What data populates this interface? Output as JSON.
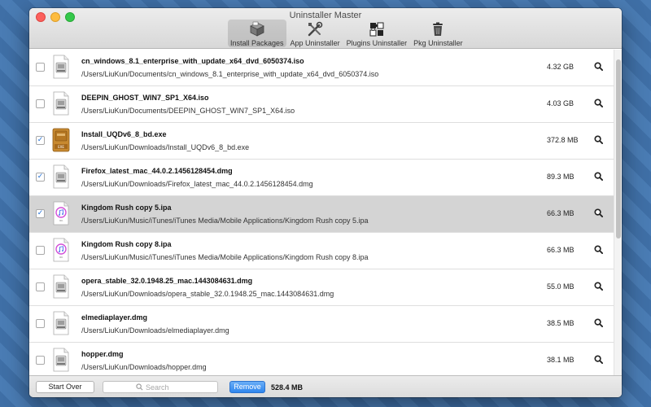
{
  "window": {
    "title": "Uninstaller Master"
  },
  "toolbar": {
    "items": [
      {
        "label": "Install Packages",
        "icon": "box-icon",
        "active": true
      },
      {
        "label": "App Uninstaller",
        "icon": "tools-icon",
        "active": false
      },
      {
        "label": "Plugins Uninstaller",
        "icon": "puzzle-icon",
        "active": false
      },
      {
        "label": "Pkg Uninstaller",
        "icon": "trash-icon",
        "active": false
      }
    ]
  },
  "files": [
    {
      "name": "cn_windows_8.1_enterprise_with_update_x64_dvd_6050374.iso",
      "path": "/Users/LiuKun/Documents/cn_windows_8.1_enterprise_with_update_x64_dvd_6050374.iso",
      "size": "4.32 GB",
      "checked": false,
      "selected": false,
      "icon": "disk-image-icon"
    },
    {
      "name": "DEEPIN_GHOST_WIN7_SP1_X64.iso",
      "path": "/Users/LiuKun/Documents/DEEPIN_GHOST_WIN7_SP1_X64.iso",
      "size": "4.03 GB",
      "checked": false,
      "selected": false,
      "icon": "disk-image-icon"
    },
    {
      "name": "Install_UQDv6_8_bd.exe",
      "path": "/Users/LiuKun/Downloads/Install_UQDv6_8_bd.exe",
      "size": "372.8 MB",
      "checked": true,
      "selected": false,
      "icon": "exe-icon"
    },
    {
      "name": "Firefox_latest_mac_44.0.2.1456128454.dmg",
      "path": "/Users/LiuKun/Downloads/Firefox_latest_mac_44.0.2.1456128454.dmg",
      "size": "89.3 MB",
      "checked": true,
      "selected": false,
      "icon": "disk-image-icon"
    },
    {
      "name": "Kingdom Rush copy 5.ipa",
      "path": "/Users/LiuKun/Music/iTunes/iTunes Media/Mobile Applications/Kingdom Rush copy 5.ipa",
      "size": "66.3 MB",
      "checked": true,
      "selected": true,
      "icon": "ipa-icon"
    },
    {
      "name": "Kingdom Rush copy 8.ipa",
      "path": "/Users/LiuKun/Music/iTunes/iTunes Media/Mobile Applications/Kingdom Rush copy 8.ipa",
      "size": "66.3 MB",
      "checked": false,
      "selected": false,
      "icon": "ipa-icon"
    },
    {
      "name": "opera_stable_32.0.1948.25_mac.1443084631.dmg",
      "path": "/Users/LiuKun/Downloads/opera_stable_32.0.1948.25_mac.1443084631.dmg",
      "size": "55.0 MB",
      "checked": false,
      "selected": false,
      "icon": "disk-image-icon"
    },
    {
      "name": "elmediaplayer.dmg",
      "path": "/Users/LiuKun/Downloads/elmediaplayer.dmg",
      "size": "38.5 MB",
      "checked": false,
      "selected": false,
      "icon": "disk-image-icon"
    },
    {
      "name": "hopper.dmg",
      "path": "/Users/LiuKun/Downloads/hopper.dmg",
      "size": "38.1 MB",
      "checked": false,
      "selected": false,
      "icon": "disk-image-icon"
    }
  ],
  "footer": {
    "start_over_label": "Start Over",
    "search_placeholder": "Search",
    "remove_label": "Remove",
    "total_size": "528.4 MB"
  },
  "colors": {
    "accent": "#2f86ee",
    "selected_row": "#d4d4d4",
    "exe_icon": "#c8892f"
  }
}
